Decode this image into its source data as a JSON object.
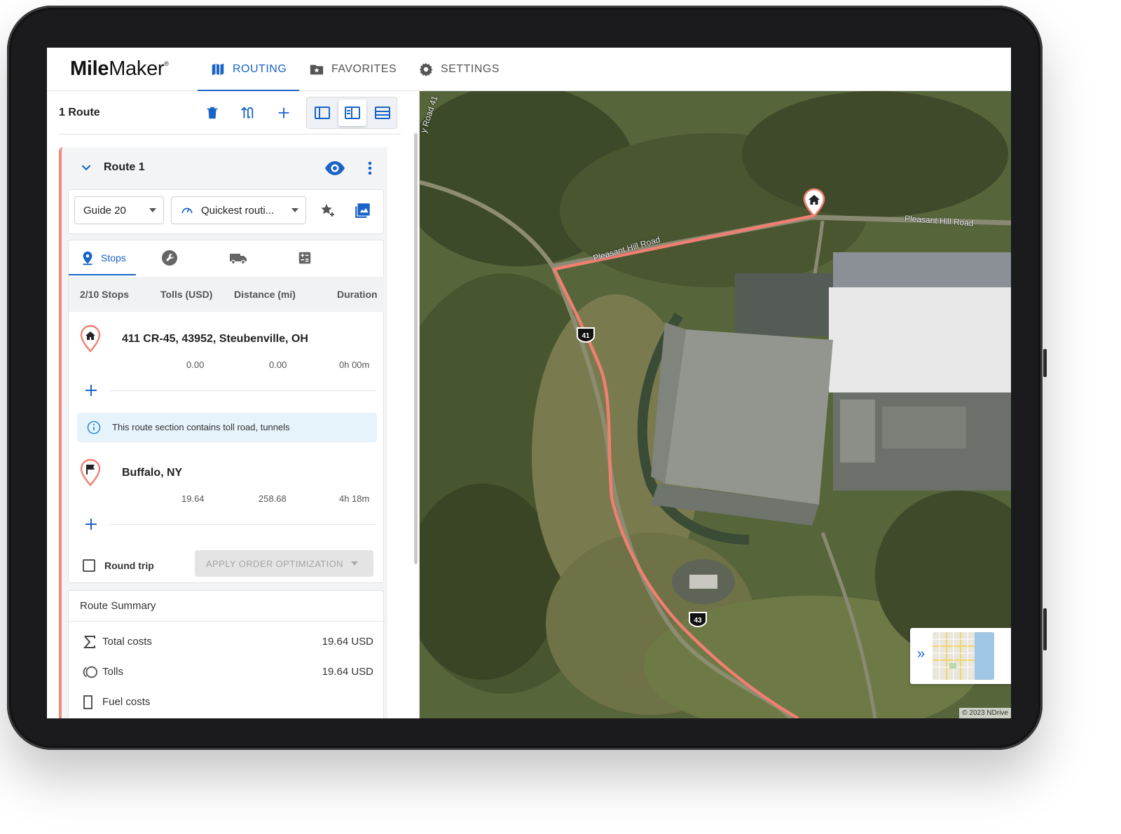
{
  "app": {
    "logo_bold": "Mile",
    "logo_light": "Maker",
    "logo_mark": "®"
  },
  "nav": {
    "tabs": [
      {
        "label": "ROUTING",
        "icon": "map-icon",
        "active": true
      },
      {
        "label": "FAVORITES",
        "icon": "folder-star-icon",
        "active": false
      },
      {
        "label": "SETTINGS",
        "icon": "gear-icon",
        "active": false
      }
    ]
  },
  "toolbar": {
    "route_count": "1 Route",
    "buttons": [
      "delete-icon",
      "swap-routes-icon",
      "add-icon"
    ],
    "layouts": [
      "layout-sidebar-icon",
      "layout-split-icon",
      "layout-list-icon"
    ],
    "active_layout": "layout-split-icon"
  },
  "route": {
    "title": "Route 1",
    "guide_select": "Guide 20",
    "routing_select": "Quickest routi...",
    "sub_tabs": [
      {
        "label": "Stops",
        "icon": "pin-icon",
        "active": true
      },
      {
        "label": "",
        "icon": "wrench-icon",
        "active": false
      },
      {
        "label": "",
        "icon": "truck-icon",
        "active": false
      },
      {
        "label": "",
        "icon": "calculator-icon",
        "active": false
      }
    ],
    "columns": [
      "2/10 Stops",
      "Tolls (USD)",
      "Distance (mi)",
      "Duration"
    ],
    "stops": [
      {
        "name": "411 CR-45, 43952, Steubenville, OH",
        "icon": "home-icon",
        "tolls": "0.00",
        "distance": "0.00",
        "duration": "0h 00m"
      },
      {
        "name": "Buffalo, NY",
        "icon": "flag-icon",
        "tolls": "19.64",
        "distance": "258.68",
        "duration": "4h 18m"
      }
    ],
    "info_message": "This route section contains toll road, tunnels",
    "round_trip_label": "Round trip",
    "round_trip_checked": false,
    "optimize_button": "APPLY ORDER OPTIMIZATION"
  },
  "summary": {
    "title": "Route Summary",
    "rows": [
      {
        "label": "Total costs",
        "value": "19.64 USD",
        "icon": "sigma-icon"
      },
      {
        "label": "Tolls",
        "value": "19.64 USD",
        "icon": "coins-icon"
      },
      {
        "label": "Fuel costs",
        "value": "",
        "icon": "fuel-icon"
      }
    ]
  },
  "map": {
    "road_labels": [
      "Pleasant Hill Road",
      "Pleasant Hill Road",
      "y Road 41"
    ],
    "shield_labels": [
      "41",
      "43"
    ],
    "copyright": "© 2023 NDrive",
    "route_color": "#f07f72"
  }
}
